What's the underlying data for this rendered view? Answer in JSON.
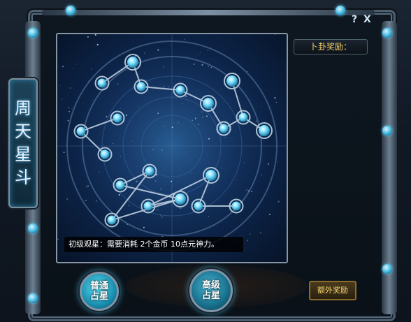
{
  "window": {
    "help_label": "?",
    "close_label": "X"
  },
  "title": {
    "chars": [
      "周",
      "天",
      "星",
      "斗"
    ]
  },
  "reward": {
    "title": "卜卦奖励："
  },
  "star_map": {
    "info_text": "初级观星：需要消耗 2个金币 10点元神力。",
    "constellation": {
      "stars": [
        {
          "id": "s1",
          "size": "small"
        },
        {
          "id": "s2",
          "size": "medium"
        },
        {
          "id": "s3",
          "size": "small"
        },
        {
          "id": "s4",
          "size": "small"
        },
        {
          "id": "s5",
          "size": "medium"
        },
        {
          "id": "s6",
          "size": "small"
        },
        {
          "id": "s7",
          "size": "small"
        },
        {
          "id": "s8",
          "size": "small"
        },
        {
          "id": "s9",
          "size": "small"
        },
        {
          "id": "s10",
          "size": "medium"
        },
        {
          "id": "s11",
          "size": "small"
        },
        {
          "id": "s12",
          "size": "medium"
        },
        {
          "id": "s13",
          "size": "small"
        },
        {
          "id": "s14",
          "size": "small"
        },
        {
          "id": "s15",
          "size": "small"
        },
        {
          "id": "s16",
          "size": "medium"
        },
        {
          "id": "s17",
          "size": "small"
        },
        {
          "id": "s18",
          "size": "medium"
        },
        {
          "id": "s19",
          "size": "small"
        },
        {
          "id": "s20",
          "size": "small"
        },
        {
          "id": "s21",
          "size": "small"
        }
      ],
      "links": [
        [
          "s1",
          "s2"
        ],
        [
          "s2",
          "s3"
        ],
        [
          "s3",
          "s4"
        ],
        [
          "s4",
          "s5"
        ],
        [
          "s5",
          "s6"
        ],
        [
          "s7",
          "s8"
        ],
        [
          "s8",
          "s9"
        ],
        [
          "s10",
          "s11"
        ],
        [
          "s11",
          "s12"
        ],
        [
          "s11",
          "s13"
        ],
        [
          "s14",
          "s15"
        ],
        [
          "s15",
          "s16"
        ],
        [
          "s16",
          "s17"
        ],
        [
          "s17",
          "s18"
        ],
        [
          "s18",
          "s19"
        ],
        [
          "s19",
          "s20"
        ],
        [
          "s14",
          "s21"
        ],
        [
          "s21",
          "s16"
        ]
      ]
    }
  },
  "buttons": {
    "normal_line1": "普通",
    "normal_line2": "占星",
    "advanced_line1": "高级",
    "advanced_line2": "占星",
    "extra_reward": "额外奖励"
  },
  "colors": {
    "star_glow": "#7fe0ff",
    "link": "#c6d6e6",
    "reward_title": "#f5d36a",
    "extra_reward_text": "#f5d76e"
  }
}
